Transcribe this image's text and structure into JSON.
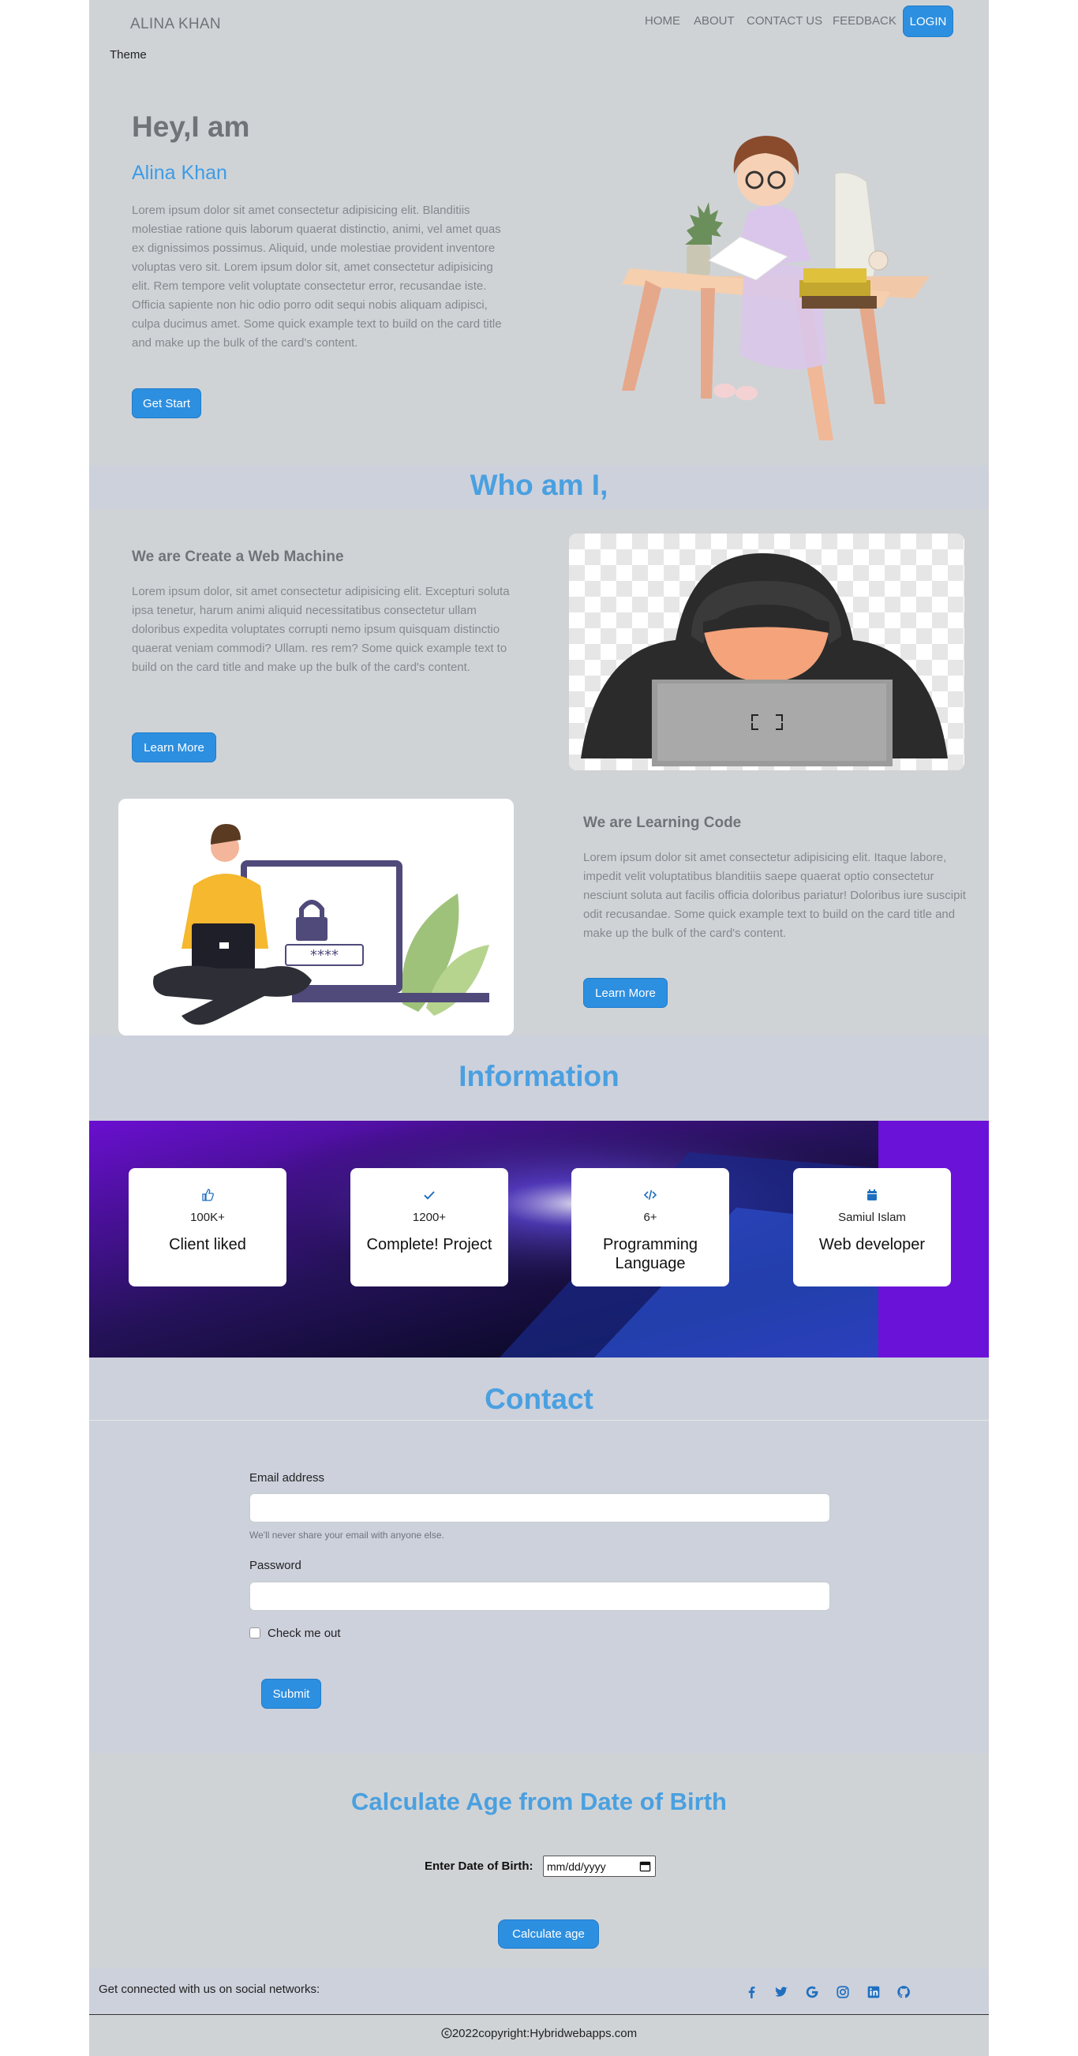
{
  "nav": {
    "brand": "ALINA KHAN",
    "links": [
      "HOME",
      "ABOUT",
      "CONTACT US",
      "FEEDBACK"
    ],
    "login": "LOGIN",
    "theme": "Theme"
  },
  "hero": {
    "title": "Hey,I am",
    "name": "Alina Khan",
    "text": "Lorem ipsum dolor sit amet consectetur adipisicing elit. Blanditiis molestiae ratione quis laborum quaerat distinctio, animi, vel amet quas ex dignissimos possimus. Aliquid, unde molestiae provident inventore voluptas vero sit. Lorem ipsum dolor sit, amet consectetur adipisicing elit. Rem tempore velit voluptate consectetur error, recusandae iste. Officia sapiente non hic odio porro odit sequi nobis aliquam adipisci, culpa ducimus amet. Some quick example text to build on the card title and make up the bulk of the card's content.",
    "button": "Get Start"
  },
  "who": {
    "heading": "Who am I,",
    "block1": {
      "title": "We are Create a Web Machine",
      "text": "Lorem ipsum dolor, sit amet consectetur adipisicing elit. Excepturi soluta ipsa tenetur, harum animi aliquid necessitatibus consectetur ullam doloribus expedita voluptates corrupti nemo ipsum quisquam distinctio quaerat veniam commodi? Ullam. res rem? Some quick example text to build on the card title and make up the bulk of the card's content.",
      "button": "Learn More"
    },
    "block2": {
      "title": "We are Learning Code",
      "text": "Lorem ipsum dolor sit amet consectetur adipisicing elit. Itaque labore, impedit velit voluptatibus blanditiis saepe quaerat optio consectetur nesciunt soluta aut facilis officia doloribus pariatur! Doloribus iure suscipit odit recusandae. Some quick example text to build on the card title and make up the bulk of the card's content.",
      "button": "Learn More"
    }
  },
  "info": {
    "heading": "Information",
    "cards": [
      {
        "icon": "thumbs-up-icon",
        "value": "100K+",
        "label": "Client liked"
      },
      {
        "icon": "check-icon",
        "value": "1200+",
        "label": "Complete! Project"
      },
      {
        "icon": "code-icon",
        "value": "6+",
        "label": "Programming Language"
      },
      {
        "icon": "calendar-icon",
        "value": "Samiul Islam",
        "label": "Web developer"
      }
    ]
  },
  "contact": {
    "heading": "Contact",
    "email_label": "Email address",
    "email_help": "We'll never share your email with anyone else.",
    "password_label": "Password",
    "check_label": "Check me out",
    "submit": "Submit"
  },
  "age": {
    "heading": "Calculate Age from Date of Birth",
    "dob_label": "Enter Date of Birth:",
    "dob_placeholder": "mm/dd/yyyy",
    "button": "Calculate age"
  },
  "footer": {
    "social_text": "Get connected with us on social networks:",
    "icons": [
      "facebook-icon",
      "twitter-icon",
      "google-icon",
      "instagram-icon",
      "linkedin-icon",
      "github-icon"
    ],
    "copyright": "2022copyright:Hybridwebapps.com"
  },
  "colors": {
    "accent": "#2d8fe0",
    "heading": "#4aa0e0",
    "page": "#d0d3d6",
    "band": "#cdd1dc"
  }
}
